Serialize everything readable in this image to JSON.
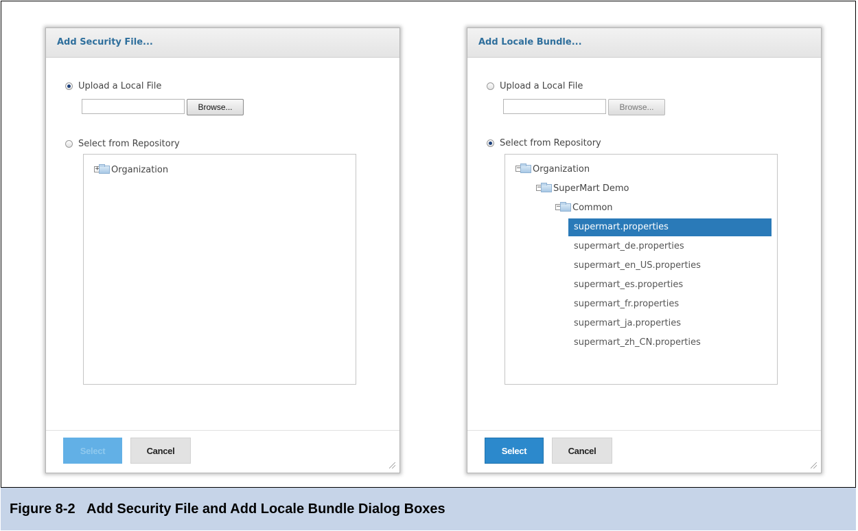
{
  "caption": {
    "number": "Figure 8-2",
    "text": "Add Security File and Add Locale Bundle Dialog Boxes"
  },
  "security_dialog": {
    "title": "Add Security File...",
    "upload_label": "Upload a Local File",
    "upload_checked": true,
    "browse_label": "Browse...",
    "file_value": "",
    "repository_label": "Select from Repository",
    "repository_checked": false,
    "tree": [
      {
        "label": "Organization",
        "expanded": false,
        "depth": 0
      }
    ],
    "select_label": "Select",
    "select_enabled": false,
    "cancel_label": "Cancel"
  },
  "locale_dialog": {
    "title": "Add Locale Bundle...",
    "upload_label": "Upload a Local File",
    "upload_checked": false,
    "browse_label": "Browse...",
    "file_value": "",
    "repository_label": "Select from Repository",
    "repository_checked": true,
    "tree": [
      {
        "label": "Organization",
        "expanded": true,
        "depth": 0
      },
      {
        "label": "SuperMart Demo",
        "expanded": true,
        "depth": 1
      },
      {
        "label": "Common",
        "expanded": true,
        "depth": 2
      }
    ],
    "files": [
      {
        "label": "supermart.properties",
        "selected": true
      },
      {
        "label": "supermart_de.properties",
        "selected": false
      },
      {
        "label": "supermart_en_US.properties",
        "selected": false
      },
      {
        "label": "supermart_es.properties",
        "selected": false
      },
      {
        "label": "supermart_fr.properties",
        "selected": false
      },
      {
        "label": "supermart_ja.properties",
        "selected": false
      },
      {
        "label": "supermart_zh_CN.properties",
        "selected": false
      }
    ],
    "select_label": "Select",
    "select_enabled": true,
    "cancel_label": "Cancel"
  },
  "colors": {
    "title_blue": "#2f6f9c",
    "selected_row": "#2a7ab8",
    "select_button": "#2c89cc",
    "caption_bar": "#c6d4e8"
  }
}
